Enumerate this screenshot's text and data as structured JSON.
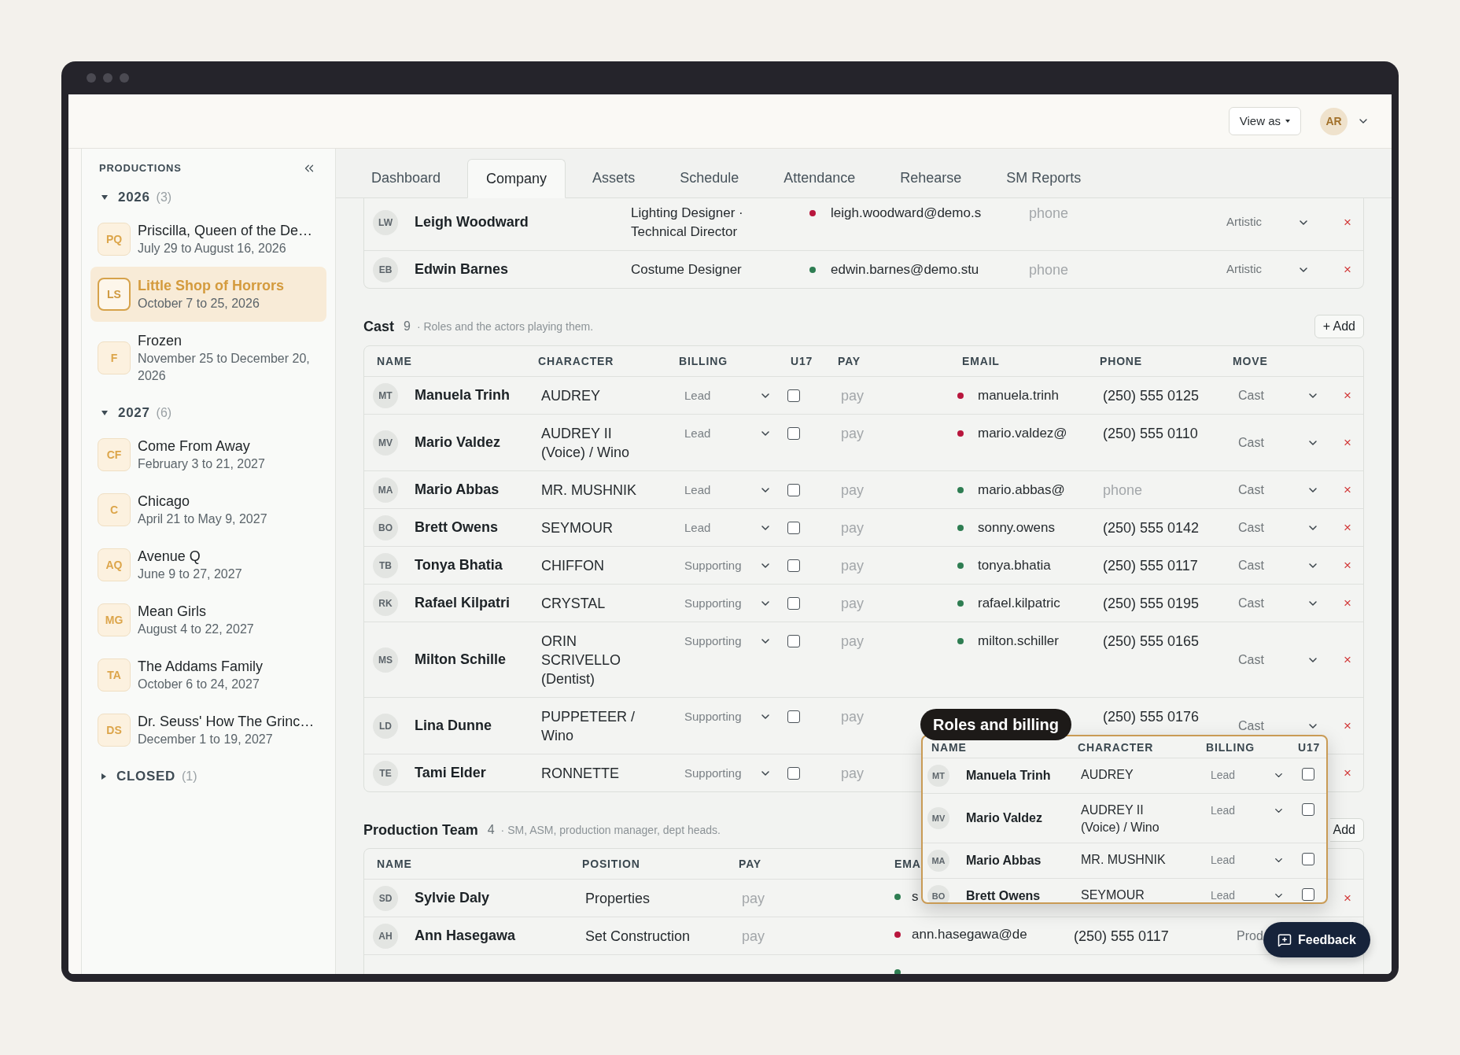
{
  "header": {
    "view_as": "View as",
    "user_initials": "AR"
  },
  "sidebar": {
    "title": "PRODUCTIONS",
    "groups": [
      {
        "label": "2026",
        "count": "(3)",
        "expanded": true,
        "items": [
          {
            "initials": "PQ",
            "title": "Priscilla, Queen of the De…",
            "dates": "July 29 to August 16, 2026",
            "selected": false
          },
          {
            "initials": "LS",
            "title": "Little Shop of Horrors",
            "dates": "October 7 to 25, 2026",
            "selected": true
          },
          {
            "initials": "F",
            "title": "Frozen",
            "dates": "November 25 to December 20, 2026",
            "selected": false
          }
        ]
      },
      {
        "label": "2027",
        "count": "(6)",
        "expanded": true,
        "items": [
          {
            "initials": "CF",
            "title": "Come From Away",
            "dates": "February 3 to 21, 2027",
            "selected": false
          },
          {
            "initials": "C",
            "title": "Chicago",
            "dates": "April 21 to May 9, 2027",
            "selected": false
          },
          {
            "initials": "AQ",
            "title": "Avenue Q",
            "dates": "June 9 to 27, 2027",
            "selected": false
          },
          {
            "initials": "MG",
            "title": "Mean Girls",
            "dates": "August 4 to 22, 2027",
            "selected": false
          },
          {
            "initials": "TA",
            "title": "The Addams Family",
            "dates": "October 6 to 24, 2027",
            "selected": false
          },
          {
            "initials": "DS",
            "title": "Dr. Seuss' How The Grinc…",
            "dates": "December 1 to 19, 2027",
            "selected": false
          }
        ]
      },
      {
        "label": "CLOSED",
        "count": "(1)",
        "expanded": false
      }
    ]
  },
  "tabs": [
    {
      "label": "Dashboard",
      "selected": false
    },
    {
      "label": "Company",
      "selected": true
    },
    {
      "label": "Assets",
      "selected": false
    },
    {
      "label": "Schedule",
      "selected": false
    },
    {
      "label": "Attendance",
      "selected": false
    },
    {
      "label": "Rehearse",
      "selected": false
    },
    {
      "label": "SM Reports",
      "selected": false
    }
  ],
  "team_continued": {
    "rows": [
      {
        "initials": "LW",
        "name": "Leigh Woodward",
        "position": "Lighting Designer · Technical Director",
        "color": "#b8163d",
        "email": "leigh.woodward@demo.s",
        "phone": {
          "placeholder": "phone"
        },
        "department": "Artistic",
        "remove": "×"
      },
      {
        "initials": "EB",
        "name": "Edwin Barnes",
        "position": "Costume Designer",
        "color": "#2e7d52",
        "email": "edwin.barnes@demo.stu",
        "phone": {
          "placeholder": "phone"
        },
        "department": "Artistic",
        "remove": "×"
      }
    ]
  },
  "cast": {
    "title": "Cast",
    "count": "9",
    "description": "· Roles and the actors playing them.",
    "add_button": "+ Add",
    "columns": [
      "NAME",
      "CHARACTER",
      "BILLING",
      "U17",
      "PAY",
      "EMAIL",
      "PHONE",
      "MOVE"
    ],
    "rows": [
      {
        "initials": "MT",
        "name": "Manuela Trinh",
        "character": "AUDREY",
        "billing": "Lead",
        "u17": false,
        "pay": {
          "placeholder": "pay"
        },
        "color": "#b8163d",
        "email": "manuela.trinh",
        "phone": {
          "value": "(250) 555 0125"
        },
        "move": "Cast",
        "remove": "×"
      },
      {
        "initials": "MV",
        "name": "Mario Valdez",
        "character": "AUDREY II (Voice) / Wino",
        "billing": "Lead",
        "u17": false,
        "pay": {
          "placeholder": "pay"
        },
        "color": "#b8163d",
        "email": "mario.valdez@",
        "phone": {
          "value": "(250) 555 0110"
        },
        "move": "Cast",
        "remove": "×"
      },
      {
        "initials": "MA",
        "name": "Mario Abbas",
        "character": "MR. MUSHNIK",
        "billing": "Lead",
        "u17": false,
        "pay": {
          "placeholder": "pay"
        },
        "color": "#2e7d52",
        "email": "mario.abbas@",
        "phone": {
          "placeholder": "phone"
        },
        "move": "Cast",
        "remove": "×"
      },
      {
        "initials": "BO",
        "name": "Brett Owens",
        "character": "SEYMOUR",
        "billing": "Lead",
        "u17": false,
        "pay": {
          "placeholder": "pay"
        },
        "color": "#2e7d52",
        "email": "sonny.owens",
        "phone": {
          "value": "(250) 555 0142"
        },
        "move": "Cast",
        "remove": "×"
      },
      {
        "initials": "TB",
        "name": "Tonya Bhatia",
        "character": "CHIFFON",
        "billing": "Supporting",
        "u17": false,
        "pay": {
          "placeholder": "pay"
        },
        "color": "#2e7d52",
        "email": "tonya.bhatia",
        "phone": {
          "value": "(250) 555 0117"
        },
        "move": "Cast",
        "remove": "×"
      },
      {
        "initials": "RK",
        "name": "Rafael Kilpatri",
        "character": "CRYSTAL",
        "billing": "Supporting",
        "u17": false,
        "pay": {
          "placeholder": "pay"
        },
        "color": "#2e7d52",
        "email": "rafael.kilpatric",
        "phone": {
          "value": "(250) 555 0195"
        },
        "move": "Cast",
        "remove": "×"
      },
      {
        "initials": "MS",
        "name": "Milton Schille",
        "character": "ORIN SCRIVELLO (Dentist)",
        "billing": "Supporting",
        "u17": false,
        "pay": {
          "placeholder": "pay"
        },
        "color": "#2e7d52",
        "email": "milton.schiller",
        "phone": {
          "value": "(250) 555 0165"
        },
        "move": "Cast",
        "remove": "×"
      },
      {
        "initials": "LD",
        "name": "Lina Dunne",
        "character": "PUPPETEER / Wino",
        "billing": "Supporting",
        "u17": false,
        "pay": {
          "placeholder": "pay"
        },
        "phone": {
          "value": "(250) 555 0176"
        },
        "move": "Cast",
        "remove": "×"
      },
      {
        "initials": "TE",
        "name": "Tami Elder",
        "character": "RONNETTE",
        "billing": "Supporting",
        "u17": false,
        "pay": {
          "placeholder": "pay"
        },
        "remove": "×"
      }
    ]
  },
  "production_team": {
    "title": "Production Team",
    "count": "4",
    "description": "· SM, ASM, production manager, dept heads.",
    "add_button": "Add",
    "columns": [
      "NAME",
      "POSITION",
      "PAY",
      "EMA"
    ],
    "rows": [
      {
        "initials": "SD",
        "name": "Sylvie Daly",
        "position": "Properties",
        "pay": {
          "placeholder": "pay"
        },
        "color": "#2e7d52",
        "email": "s",
        "remove": "×"
      },
      {
        "initials": "AH",
        "name": "Ann Hasegawa",
        "position": "Set Construction",
        "pay": {
          "placeholder": "pay"
        },
        "color": "#b8163d",
        "email": "ann.hasegawa@de",
        "phone": {
          "value": "(250) 555 0117"
        },
        "move": {
          "value": "Prod",
          "caret": false
        }
      },
      {
        "color": "#2e7d52"
      }
    ]
  },
  "callout": {
    "label": "Roles and billing",
    "columns": [
      "NAME",
      "CHARACTER",
      "BILLING",
      "U17"
    ],
    "rows": [
      {
        "initials": "MT",
        "name": "Manuela Trinh",
        "character": "AUDREY",
        "billing": "Lead",
        "u17": false
      },
      {
        "initials": "MV",
        "name": "Mario Valdez",
        "character": "AUDREY II (Voice) / Wino",
        "billing": "Lead",
        "u17": false
      },
      {
        "initials": "MA",
        "name": "Mario Abbas",
        "character": "MR. MUSHNIK",
        "billing": "Lead",
        "u17": false
      },
      {
        "initials": "BO",
        "name": "Brett Owens",
        "character": "SEYMOUR",
        "billing": "Lead",
        "u17": false
      }
    ]
  },
  "feedback_button": "Feedback"
}
